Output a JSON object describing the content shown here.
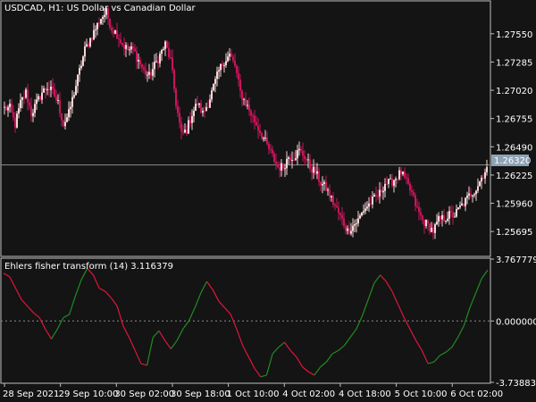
{
  "chart": {
    "title": "USDCAD, H1:  US Dollar vs Canadian Dollar",
    "indicator_title": "Ehlers fisher transform (14) 3.116379",
    "current_price_label": "1.26320",
    "colors": {
      "background": "#141414",
      "frame": "#bfbfbf",
      "bull": "#f5d5d5",
      "bear": "#c8145a",
      "fisher_up": "#228b22",
      "fisher_down": "#e0153c",
      "price_tag_bg": "#8ea2b4"
    }
  },
  "chart_data": [
    {
      "type": "candlestick",
      "title": "USDCAD, H1:  US Dollar vs Canadian Dollar",
      "y_ticks": [
        "1.27550",
        "1.27285",
        "1.27020",
        "1.26755",
        "1.26490",
        "1.26225",
        "1.25960",
        "1.25695"
      ],
      "ylim": [
        1.2547,
        1.2785
      ],
      "current_price": 1.2632,
      "x_ticks": [
        "28 Sep 2021",
        "29 Sep 10:00",
        "30 Sep 02:00",
        "30 Sep 18:00",
        "1 Oct 10:00",
        "4 Oct 02:00",
        "4 Oct 18:00",
        "5 Oct 10:00",
        "6 Oct 02:00"
      ],
      "close_path": [
        1.2685,
        1.2685,
        1.267,
        1.269,
        1.27,
        1.268,
        1.269,
        1.27,
        1.2705,
        1.27,
        1.269,
        1.267,
        1.268,
        1.27,
        1.272,
        1.274,
        1.275,
        1.276,
        1.277,
        1.2775,
        1.276,
        1.2755,
        1.2745,
        1.274,
        1.274,
        1.273,
        1.272,
        1.2715,
        1.2725,
        1.2735,
        1.2745,
        1.273,
        1.269,
        1.266,
        1.2665,
        1.268,
        1.269,
        1.268,
        1.269,
        1.2705,
        1.272,
        1.273,
        1.2735,
        1.2725,
        1.27,
        1.269,
        1.268,
        1.267,
        1.266,
        1.265,
        1.264,
        1.263,
        1.263,
        1.264,
        1.264,
        1.2645,
        1.264,
        1.263,
        1.2625,
        1.2615,
        1.261,
        1.26,
        1.259,
        1.258,
        1.257,
        1.2575,
        1.258,
        1.259,
        1.2595,
        1.26,
        1.2605,
        1.2615,
        1.2615,
        1.262,
        1.2625,
        1.2615,
        1.2605,
        1.259,
        1.258,
        1.2575,
        1.257,
        1.258,
        1.2582,
        1.2585,
        1.2585,
        1.2592,
        1.2598,
        1.2605,
        1.261,
        1.262,
        1.263
      ]
    },
    {
      "type": "line",
      "title": "Ehlers fisher transform (14) 3.116379",
      "y_ticks": [
        "3.767779",
        "0.000000",
        "-3.738836"
      ],
      "ylim": [
        -3.738836,
        3.767779
      ],
      "latest_value": 3.116379,
      "values": [
        2.9,
        2.7,
        2.0,
        1.3,
        0.9,
        0.5,
        0.2,
        -0.5,
        -1.1,
        -0.5,
        0.2,
        0.4,
        1.5,
        2.5,
        3.2,
        2.8,
        2.0,
        1.8,
        1.4,
        0.9,
        -0.3,
        -1.0,
        -1.8,
        -2.6,
        -2.7,
        -1.0,
        -0.6,
        -1.2,
        -1.7,
        -1.2,
        -0.5,
        0.0,
        0.8,
        1.7,
        2.4,
        1.9,
        1.2,
        0.8,
        0.4,
        -0.5,
        -1.5,
        -2.2,
        -2.9,
        -3.4,
        -3.3,
        -2.0,
        -1.6,
        -1.3,
        -1.8,
        -2.2,
        -2.8,
        -3.1,
        -3.3,
        -2.8,
        -2.5,
        -2.0,
        -1.8,
        -1.5,
        -1.0,
        -0.5,
        0.3,
        1.3,
        2.3,
        2.8,
        2.4,
        1.8,
        1.0,
        0.2,
        -0.5,
        -1.2,
        -1.8,
        -2.6,
        -2.5,
        -2.1,
        -1.9,
        -1.6,
        -1.0,
        -0.3,
        0.8,
        1.7,
        2.6,
        3.1
      ]
    }
  ]
}
